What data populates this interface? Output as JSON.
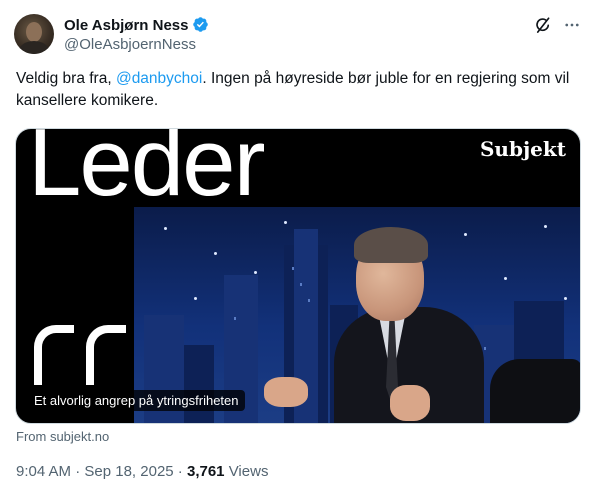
{
  "author": {
    "name": "Ole Asbjørn Ness",
    "handle": "@OleAsbjoernNess",
    "verified": true
  },
  "tweet": {
    "text_before": "Veldig bra fra, ",
    "mention": "@danbychoi",
    "text_after": ". Ingen på høyreside  bør juble for en regjering som vil kansellere komikere."
  },
  "card": {
    "headline_graphic": "Leder",
    "brand": "Subjekt",
    "caption": "Et alvorlig angrep på ytringsfriheten",
    "source": "From subjekt.no"
  },
  "meta": {
    "time": "9:04 AM",
    "separator": " · ",
    "date": "Sep 18, 2025",
    "views_count": "3,761",
    "views_label": " Views"
  },
  "icons": {
    "verified": "verified-badge-icon",
    "grok": "grok-icon",
    "more": "more-icon"
  },
  "colors": {
    "accent": "#1d9bf0",
    "text": "#0f1419",
    "muted": "#536471"
  }
}
